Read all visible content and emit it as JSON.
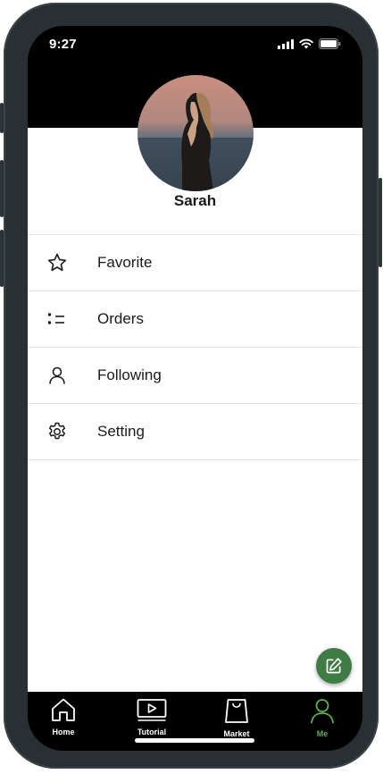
{
  "status_bar": {
    "time": "9:27"
  },
  "profile": {
    "name": "Sarah"
  },
  "menu": [
    {
      "label": "Favorite",
      "icon": "star-icon"
    },
    {
      "label": "Orders",
      "icon": "list-icon"
    },
    {
      "label": "Following",
      "icon": "person-icon"
    },
    {
      "label": "Setting",
      "icon": "gear-icon"
    }
  ],
  "fab": {
    "icon": "edit-icon"
  },
  "tabbar": {
    "tabs": [
      {
        "label": "Home",
        "icon": "home-icon"
      },
      {
        "label": "Tutorial",
        "icon": "video-icon"
      },
      {
        "label": "Market",
        "icon": "shopping-bag-icon"
      },
      {
        "label": "Me",
        "icon": "person-icon",
        "active": true
      }
    ]
  },
  "colors": {
    "accent": "#5fb34f",
    "fab": "#3e7c43",
    "header": "#000000"
  }
}
